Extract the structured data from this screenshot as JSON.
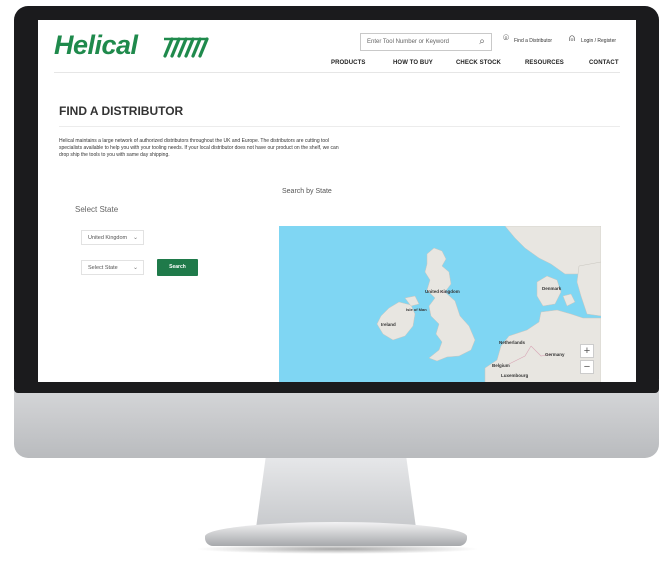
{
  "header": {
    "logo_text": "Helical",
    "search_placeholder": "Enter Tool Number or Keyword",
    "find_distributor": "Find a Distributor",
    "login": "Login / Register",
    "nav": [
      "PRODUCTS",
      "HOW TO BUY",
      "CHECK STOCK",
      "RESOURCES",
      "CONTACT"
    ]
  },
  "page": {
    "title": "FIND A DISTRIBUTOR",
    "intro": "Helical maintains a large network of authorized distributors throughout the UK and Europe. The distributors are cutting tool specialists available to help you with your tooling needs. If your local distributor does not have our product on the shelf, we can drop ship the tools to you with same day shipping.",
    "select_label": "Select State",
    "country_value": "United Kingdom",
    "state_value": "Select State",
    "search_button": "Search",
    "map_label": "Search by State"
  },
  "map": {
    "labels": {
      "uk": "United Kingdom",
      "isle_of_man": "Isle of Man",
      "ireland": "Ireland",
      "denmark": "Denmark",
      "netherlands": "Netherlands",
      "germany": "Germany",
      "belgium": "Belgium",
      "luxembourg": "Luxembourg"
    },
    "zoom_in": "+",
    "zoom_out": "−"
  },
  "colors": {
    "brand": "#1f8a4c",
    "button": "#1f7a4a",
    "sea": "#7fd6f3",
    "land": "#e8e6e1"
  },
  "icons": [
    "search-icon",
    "location-pin-icon",
    "user-icon",
    "chevron-down-icon"
  ]
}
